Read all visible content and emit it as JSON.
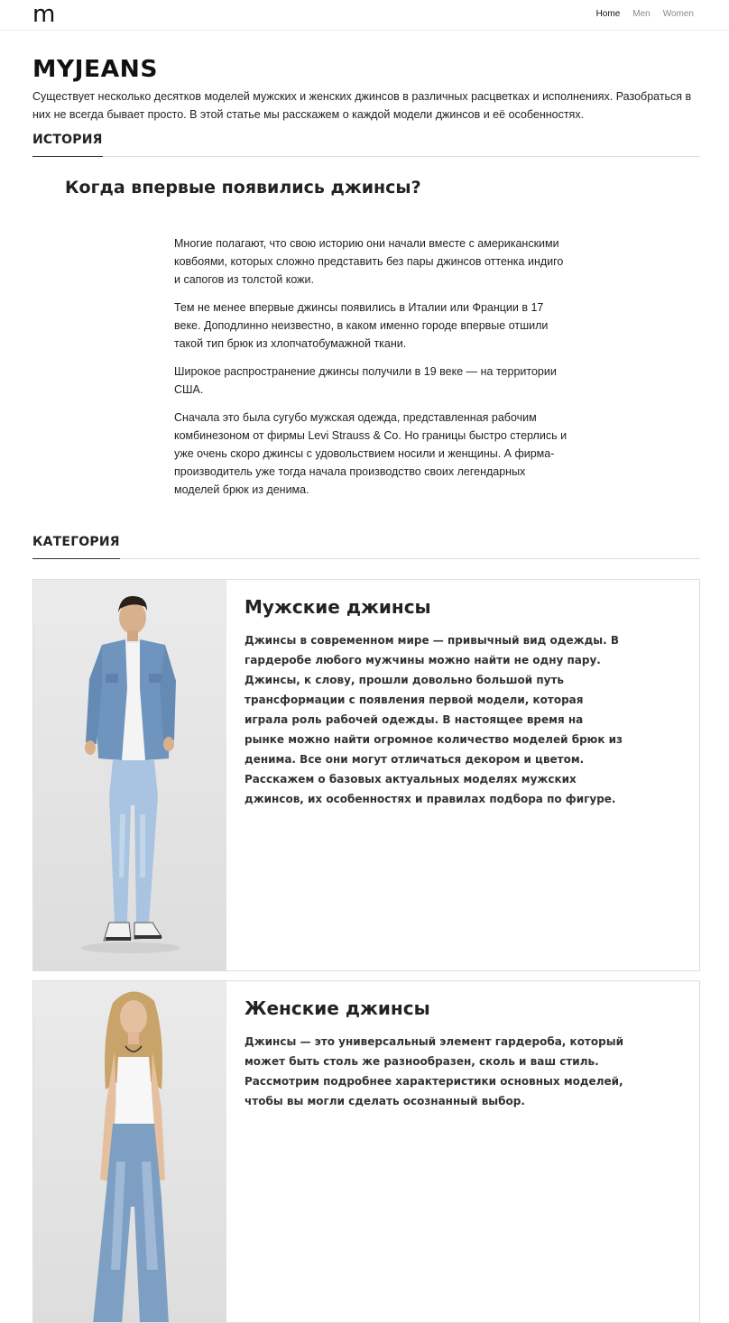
{
  "navbar": {
    "brand": "m",
    "links": [
      "Home",
      "Men",
      "Women"
    ]
  },
  "header": {
    "logo": "MYJEANS",
    "lead": "Существует несколько десятков моделей мужских и женских джинсов в различных расцветках и исполнениях. Разобраться в них не всегда бывает просто. В этой статье мы расскажем о каждой модели джинсов и её особенностях."
  },
  "history": {
    "heading": "ИСТОРИЯ",
    "question": "Когда впервые появились джинсы?",
    "paragraphs": [
      "Многие полагают, что свою историю они начали вместе с американскими ковбоями, которых сложно представить без пары джинсов оттенка индиго и сапогов из толстой кожи.",
      "Тем не менее впервые джинсы появились в Италии или Франции в 17 веке. Доподлинно неизвестно, в каком именно городе впервые отшили такой тип брюк из хлопчатобумажной ткани.",
      "Широкое распространение джинсы получили в 19 веке — на территории США.",
      "Сначала это была сугубо мужская одежда, представленная рабочим комбинезоном от фирмы Levi Strauss & Co. Но границы быстро стерлись и уже очень скоро джинсы с удовольствием носили и женщины. А фирма-производитель уже тогда начала производство своих легендарных моделей брюк из денима."
    ]
  },
  "category": {
    "heading": "КАТЕГОРИЯ",
    "cards": [
      {
        "title": "Мужские джинсы",
        "text": "Джинсы в современном мире — привычный вид одежды. В гардеробе любого мужчины можно найти не одну пару. Джинсы, к слову, прошли довольно большой путь трансформации с появления первой модели, которая играла роль рабочей одежды. В настоящее время на рынке можно найти огромное количество моделей брюк из денима. Все они могут отличаться декором и цветом. Расскажем о базовых актуальных моделях мужских джинсов, их особенностях и правилах подбора по фигуре."
      },
      {
        "title": "Женские джинсы",
        "text": "Джинсы — это универсальный элемент гардероба, который может быть столь же разнообразен, сколь и ваш стиль. Рассмотрим подробнее характеристики основных моделей, чтобы вы могли сделать осознанный выбор."
      }
    ]
  },
  "colors": {
    "text": "#222222",
    "muted": "#888888",
    "border": "#dedede",
    "denim": "#6f95bf",
    "light_denim": "#a9c4e0"
  }
}
